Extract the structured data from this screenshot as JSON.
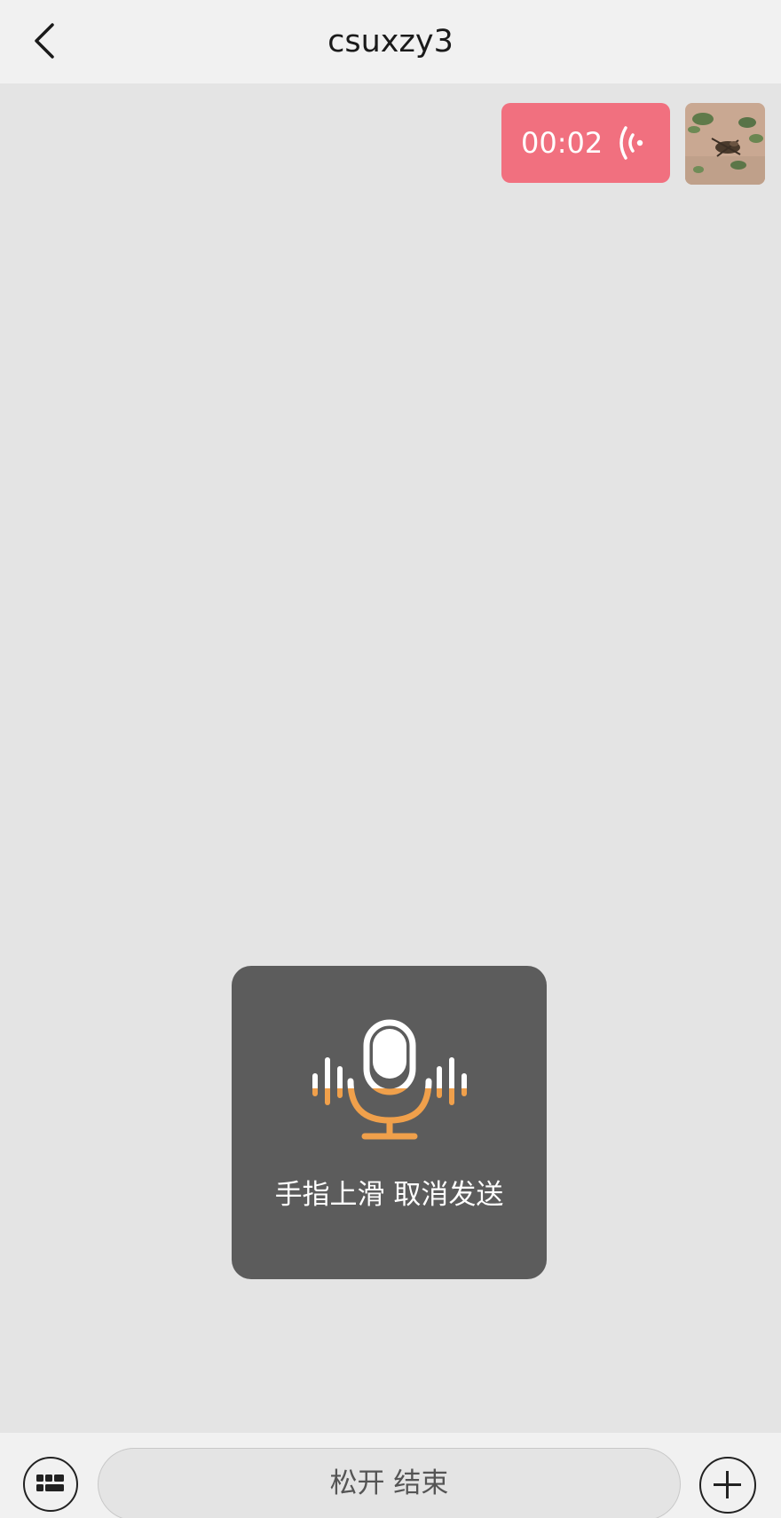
{
  "header": {
    "title": "csuxzy3",
    "back_icon": "chevron-left-icon"
  },
  "messages": [
    {
      "type": "voice",
      "duration": "00:02",
      "bubble_color": "#f1707f",
      "icon": "voice-wave-icon",
      "sender_avatar": "avatar-photo"
    }
  ],
  "recording": {
    "hint": "手指上滑 取消发送",
    "icon": "microphone-icon",
    "accent_color": "#f0a04b"
  },
  "input_bar": {
    "keyboard_icon": "keyboard-icon",
    "hold_label": "松开 结束",
    "plus_icon": "plus-icon"
  }
}
